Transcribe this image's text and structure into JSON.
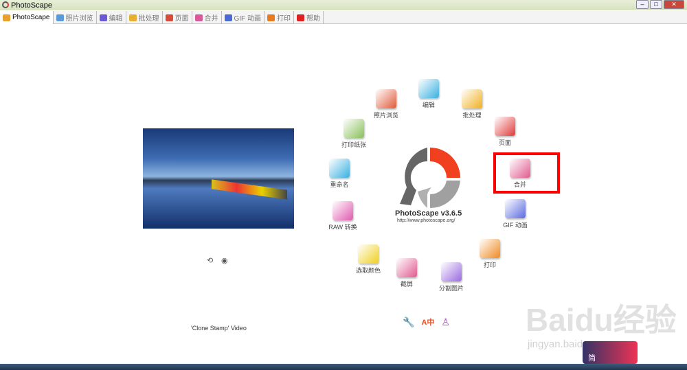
{
  "window": {
    "title": "PhotoScape"
  },
  "tabs": [
    {
      "label": "PhotoScape",
      "color": "#e8a030"
    },
    {
      "label": "照片浏览",
      "color": "#5a9ad8"
    },
    {
      "label": "编辑",
      "color": "#6a5ad8"
    },
    {
      "label": "批处理",
      "color": "#e8b030"
    },
    {
      "label": "页面",
      "color": "#d84a3a"
    },
    {
      "label": "合并",
      "color": "#d85a9a"
    },
    {
      "label": "GIF 动画",
      "color": "#4a6ad8"
    },
    {
      "label": "打印",
      "color": "#e87a20"
    },
    {
      "label": "帮助",
      "color": "#e02020"
    }
  ],
  "home": {
    "caption": "'Clone Stamp' Video",
    "version": "PhotoScape v3.6.5",
    "url": "http://www.photoscape.org/",
    "menu": [
      {
        "label": "照片浏览",
        "color": "#e05a3a"
      },
      {
        "label": "编辑",
        "color": "#3ab0e0"
      },
      {
        "label": "批处理",
        "color": "#f0b020"
      },
      {
        "label": "页面",
        "color": "#e03a3a"
      },
      {
        "label": "合并",
        "color": "#e05a90"
      },
      {
        "label": "GIF 动画",
        "color": "#5a6ae0"
      },
      {
        "label": "打印",
        "color": "#f08a20"
      },
      {
        "label": "分割图片",
        "color": "#9a6ae0"
      },
      {
        "label": "截屏",
        "color": "#e05a90"
      },
      {
        "label": "选取颜色",
        "color": "#f0d020"
      },
      {
        "label": "RAW 转换",
        "color": "#e05ab0"
      },
      {
        "label": "重命名",
        "color": "#3ab0e0"
      },
      {
        "label": "打印纸张",
        "color": "#8ac05a"
      }
    ],
    "bottom_icons": {
      "lang": "A中"
    }
  },
  "watermark": {
    "text": "Baidu经验",
    "sub": "jingyan.baidu.com",
    "badge": "简"
  }
}
